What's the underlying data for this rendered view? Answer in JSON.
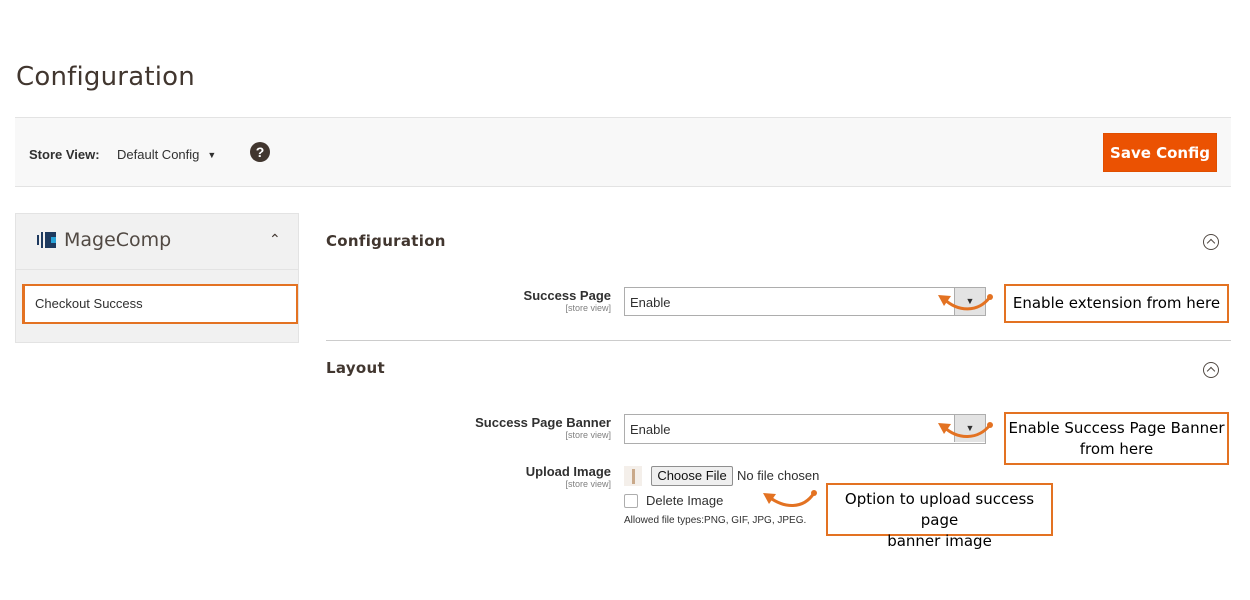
{
  "page": {
    "title": "Configuration"
  },
  "toolbar": {
    "store_view_label": "Store View:",
    "store_view_value": "Default Config",
    "help_glyph": "?",
    "save_label": "Save Config"
  },
  "sidebar": {
    "brand": "MageComp",
    "items": [
      {
        "label": "Checkout Success"
      }
    ]
  },
  "sections": {
    "configuration": {
      "title": "Configuration",
      "fields": [
        {
          "label": "Success Page",
          "scope": "[store view]",
          "value": "Enable"
        }
      ]
    },
    "layout": {
      "title": "Layout",
      "fields": [
        {
          "label": "Success Page Banner",
          "scope": "[store view]",
          "value": "Enable"
        },
        {
          "label": "Upload Image",
          "scope": "[store view]",
          "choose_label": "Choose File",
          "no_file": "No file chosen",
          "delete_label": "Delete Image",
          "allowed": "Allowed file types:PNG, GIF, JPG, JPEG."
        }
      ]
    }
  },
  "callouts": {
    "enable_extension": "Enable extension from here",
    "enable_banner_1": "Enable Success Page Banner",
    "enable_banner_2": "from here",
    "upload_option_1": "Option to upload success page",
    "upload_option_2": "banner image"
  },
  "colors": {
    "accent": "#eb5202",
    "callout_border": "#e37222"
  },
  "icons": {
    "help": "help-icon",
    "collapse": "chevron-up-circle-icon",
    "dropdown": "caret-down-icon"
  }
}
